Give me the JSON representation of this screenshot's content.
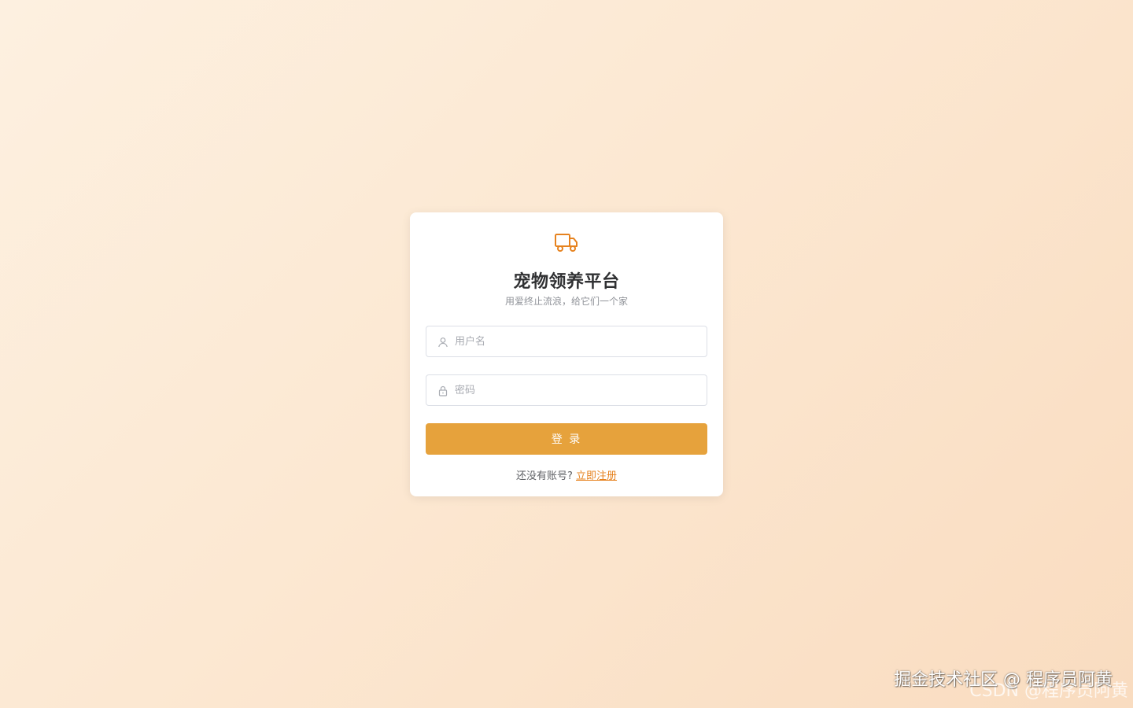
{
  "app": {
    "title": "宠物领养平台",
    "subtitle": "用爱终止流浪，给它们一个家",
    "logo_icon": "truck-icon",
    "accent_color": "#e6a23c",
    "link_color": "#e6821e"
  },
  "form": {
    "username": {
      "icon": "user-icon",
      "placeholder": "用户名",
      "value": ""
    },
    "password": {
      "icon": "lock-icon",
      "placeholder": "密码",
      "value": ""
    },
    "login_label": "登 录"
  },
  "register": {
    "prompt": "还没有账号?",
    "link_label": "立即注册"
  },
  "watermarks": {
    "primary": "掘金技术社区 @ 程序员阿黄",
    "secondary": "CSDN @程序员阿黄"
  }
}
